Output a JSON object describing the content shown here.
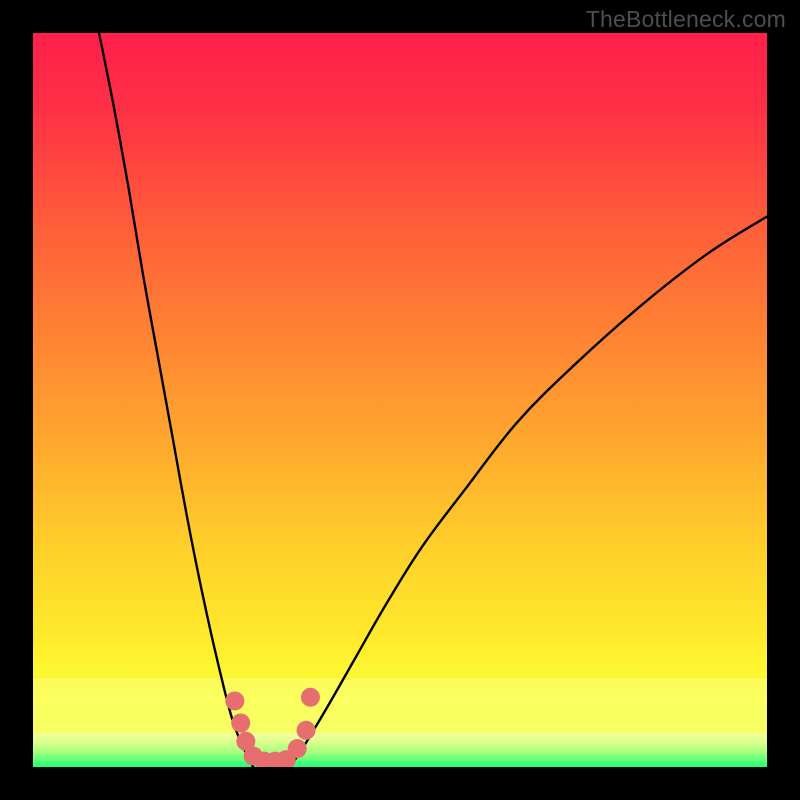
{
  "watermark": "TheBottleneck.com",
  "chart_data": {
    "type": "line",
    "title": "",
    "xlabel": "",
    "ylabel": "",
    "xlim": [
      0,
      100
    ],
    "ylim": [
      0,
      100
    ],
    "grid": false,
    "series": [
      {
        "name": "left-curve",
        "x": [
          9,
          11,
          13,
          15,
          17,
          19,
          21,
          23,
          25,
          27,
          28.5,
          30
        ],
        "values": [
          100,
          90,
          79,
          67,
          56,
          45,
          34,
          24,
          15,
          7,
          3,
          0
        ]
      },
      {
        "name": "right-curve",
        "x": [
          35,
          37,
          40,
          44,
          48,
          53,
          59,
          66,
          74,
          83,
          92,
          100
        ],
        "values": [
          0,
          3,
          8,
          15,
          22,
          30,
          38,
          47,
          55,
          63,
          70,
          75
        ]
      }
    ],
    "markers": {
      "name": "highlight-dots",
      "color": "#e66e6e",
      "x": [
        27.5,
        28.3,
        29.0,
        30.0,
        31.5,
        33.0,
        34.5,
        36.0,
        37.2,
        37.8
      ],
      "values": [
        9.0,
        6.0,
        3.5,
        1.5,
        0.8,
        0.8,
        1.0,
        2.5,
        5.0,
        9.5
      ]
    },
    "green_band": {
      "y_from": 0,
      "y_to": 4
    }
  }
}
